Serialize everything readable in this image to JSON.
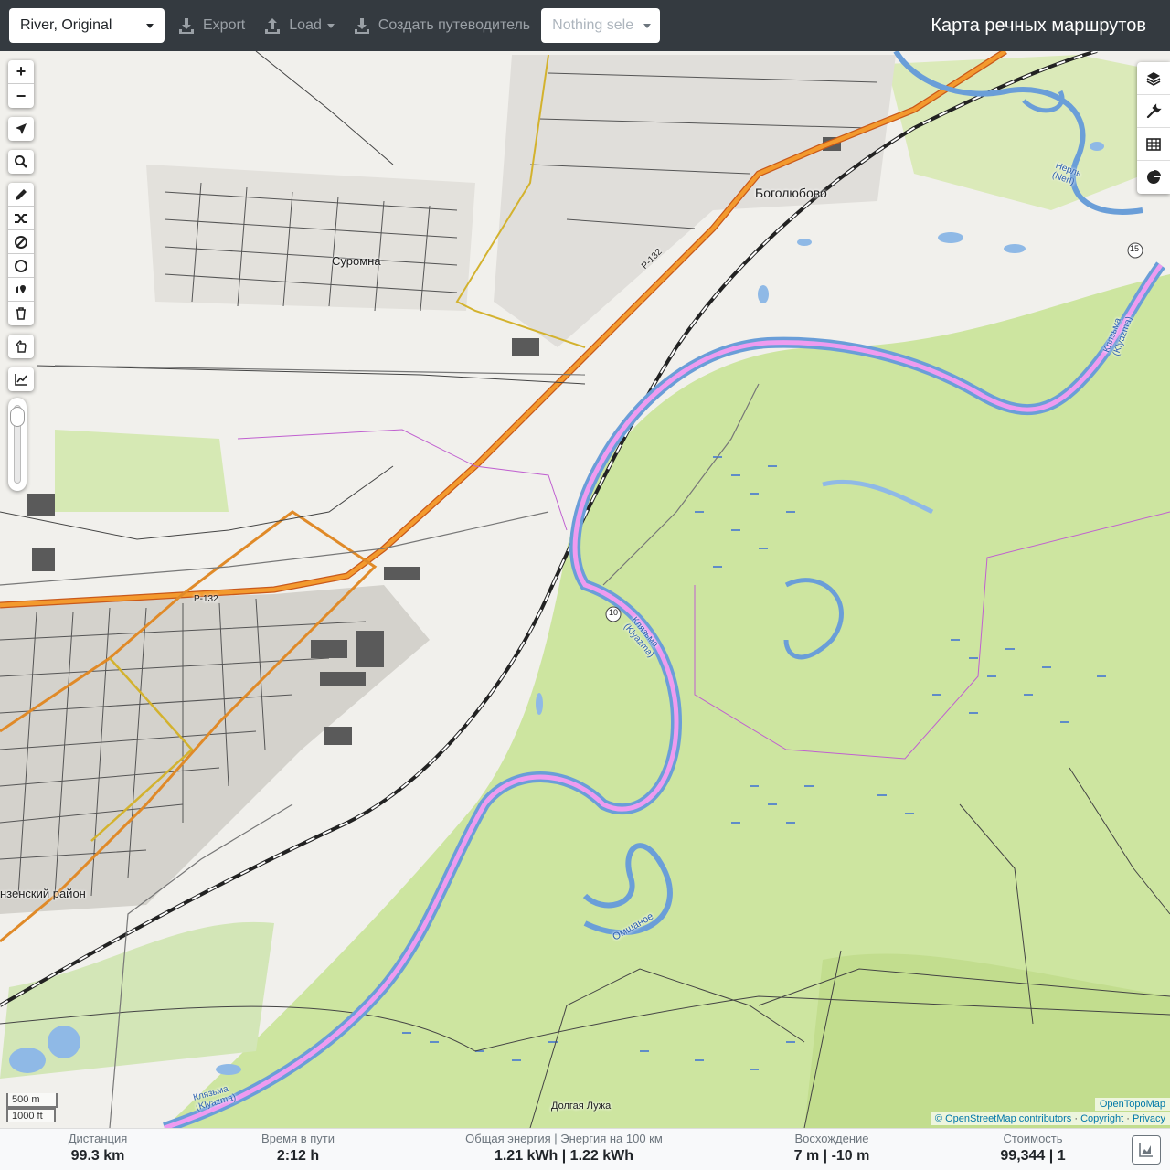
{
  "navbar": {
    "profile": "River, Original",
    "export_label": "Export",
    "load_label": "Load",
    "guide_label": "Создать путеводитель",
    "selection_placeholder": "Nothing sele",
    "brand": "Карта речных маршрутов"
  },
  "map": {
    "labels": {
      "town1": "Суромна",
      "town2": "Боголюбово",
      "district": "нзенский район",
      "village": "Долгая Лужа",
      "lake": "Омшаное",
      "river1": "Клязьма (Klyazma)",
      "river2": "Клязьма (Klyazma)",
      "river3": "Клязьма (Klyazma)",
      "river4": "Нерль (Nerl)",
      "road1": "Р-132",
      "road2": "Р-132",
      "km10": "10",
      "km15": "15"
    },
    "scale": {
      "metric": "500 m",
      "imperial": "1000 ft"
    },
    "attribution": {
      "tiles": "OpenTopoMap",
      "osm": "© OpenStreetMap contributors",
      "sep": "·",
      "copyright": "Copyright",
      "privacy": "Privacy"
    },
    "colors": {
      "route": "#b040e0",
      "major_road": "#f08a1a",
      "forest": "#c8e29a",
      "river": "#6a9ed8"
    }
  },
  "stats": {
    "distance_label": "Дистанция",
    "distance_value": "99.3 km",
    "time_label": "Время в пути",
    "time_value": "2:12 h",
    "energy_label": "Общая энергия | Энергия на 100 км",
    "energy_value": "1.21 kWh | 1.22 kWh",
    "ascent_label": "Восхождение",
    "ascent_value": "7 m | -10 m",
    "cost_label": "Стоимость",
    "cost_value": "99,344 | 1"
  }
}
